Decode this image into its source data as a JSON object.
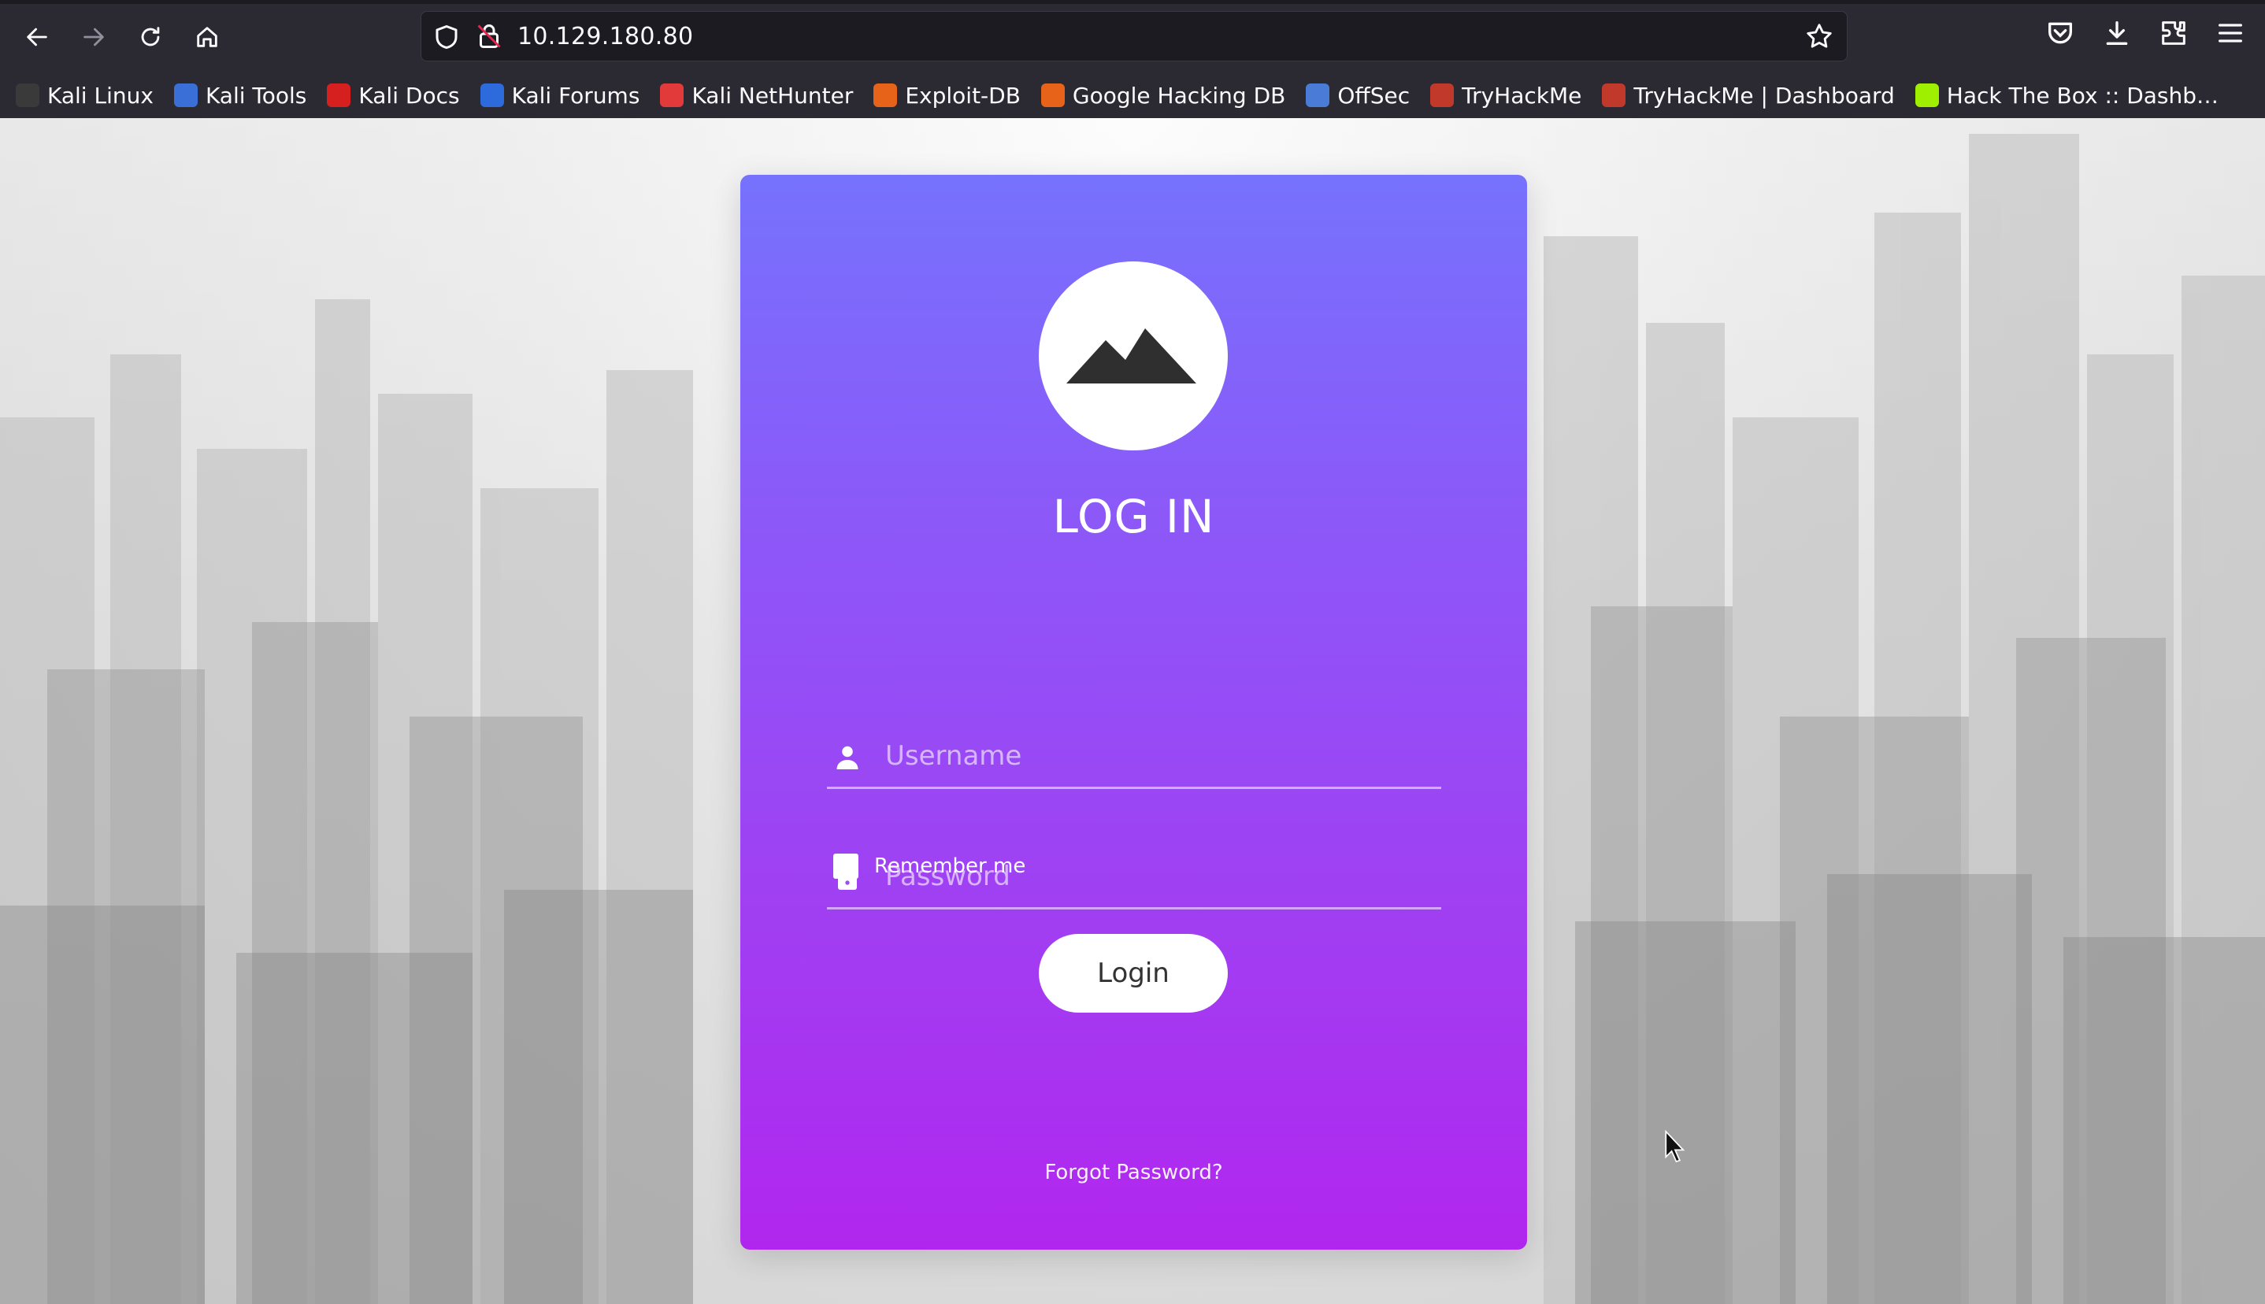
{
  "browser": {
    "url": "10.129.180.80",
    "bookmarks": [
      {
        "label": "Kali Linux",
        "icon": "kali-dragon-icon",
        "color": "#3a3a3a"
      },
      {
        "label": "Kali Tools",
        "icon": "kali-tools-icon",
        "color": "#3b6fd8"
      },
      {
        "label": "Kali Docs",
        "icon": "kali-docs-icon",
        "color": "#d61f1f"
      },
      {
        "label": "Kali Forums",
        "icon": "kali-forums-icon",
        "color": "#2d6bdc"
      },
      {
        "label": "Kali NetHunter",
        "icon": "nethunter-icon",
        "color": "#e23a3a"
      },
      {
        "label": "Exploit-DB",
        "icon": "exploit-db-icon",
        "color": "#e8631a"
      },
      {
        "label": "Google Hacking DB",
        "icon": "ghdb-icon",
        "color": "#e8631a"
      },
      {
        "label": "OffSec",
        "icon": "offsec-icon",
        "color": "#4a7bd6"
      },
      {
        "label": "TryHackMe",
        "icon": "tryhackme-icon",
        "color": "#c0392b"
      },
      {
        "label": "TryHackMe | Dashboard",
        "icon": "tryhackme-icon",
        "color": "#c0392b"
      },
      {
        "label": "Hack The Box :: Dashb…",
        "icon": "hackthebox-icon",
        "color": "#9fef00"
      }
    ]
  },
  "login": {
    "title": "LOG IN",
    "username_placeholder": "Username",
    "password_placeholder": "Password",
    "remember_label": "Remember me",
    "login_label": "Login",
    "forgot_label": "Forgot Password?"
  }
}
